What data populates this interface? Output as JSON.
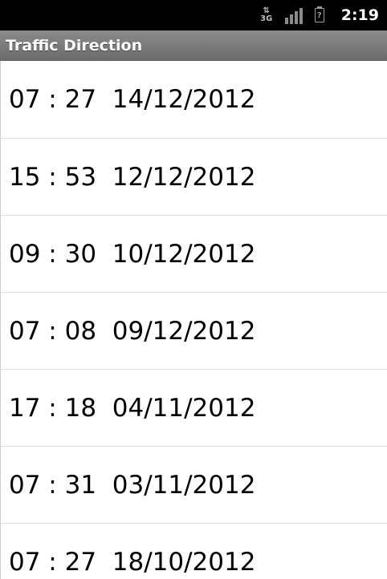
{
  "status_bar": {
    "network": "3G",
    "clock": "2:19",
    "icons": [
      "data-arrows-3g-icon",
      "signal-strength-icon",
      "battery-unknown-icon"
    ]
  },
  "app": {
    "title": "Traffic Direction"
  },
  "list": {
    "items": [
      {
        "time": "07 : 27",
        "date": "14/12/2012"
      },
      {
        "time": "15 : 53",
        "date": "12/12/2012"
      },
      {
        "time": "09 : 30",
        "date": "10/12/2012"
      },
      {
        "time": "07 : 08",
        "date": "09/12/2012"
      },
      {
        "time": "17 : 18",
        "date": "04/11/2012"
      },
      {
        "time": "07 : 31",
        "date": "03/11/2012"
      },
      {
        "time": "07 : 27",
        "date": "18/10/2012"
      }
    ]
  },
  "colors": {
    "status_bar_bg": "#000000",
    "title_bar_bg": "#7a7a7a",
    "list_bg": "#ffffff",
    "divider": "#e3e3e3",
    "text": "#000000"
  }
}
